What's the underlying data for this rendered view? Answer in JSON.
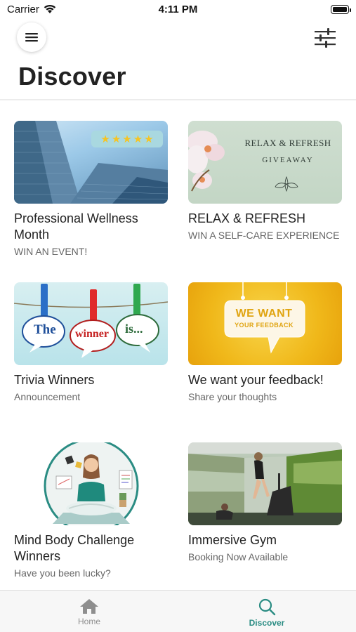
{
  "status_bar": {
    "carrier": "Carrier",
    "time": "4:11 PM"
  },
  "header": {
    "title": "Discover",
    "menu_icon": "hamburger-menu-icon",
    "filter_icon": "sliders-filter-icon"
  },
  "cards": [
    {
      "title": "Professional Wellness Month",
      "subtitle": "WIN AN EVENT!",
      "image": "skyscraper-photo",
      "rating_stars": 5
    },
    {
      "title": "RELAX & REFRESH",
      "subtitle": "WIN A SELF-CARE EXPERIENCE",
      "image": "orchid-giveaway-banner",
      "image_text": {
        "title": "RELAX & REFRESH",
        "sub": "GIVEAWAY"
      }
    },
    {
      "title": "Trivia Winners",
      "subtitle": "Announcement",
      "image": "clothespin-speech-bubbles",
      "image_text": {
        "word1": "The",
        "word2": "winner",
        "word3": "is..."
      }
    },
    {
      "title": "We want your feedback!",
      "subtitle": "Share your thoughts",
      "image": "feedback-sign",
      "image_text": {
        "line1": "WE WANT",
        "line2": "YOUR FEEDBACK"
      }
    },
    {
      "title": "Mind Body Challenge Winners",
      "subtitle": "Have you been lucky?",
      "image": "meditation-illustration"
    },
    {
      "title": "Immersive Gym",
      "subtitle": "Booking Now Available",
      "image": "treadmill-gym-photo"
    }
  ],
  "tab_bar": {
    "home_label": "Home",
    "discover_label": "Discover",
    "home_icon": "house-icon",
    "discover_icon": "search-icon",
    "active_tab": "Discover"
  },
  "colors": {
    "accent": "#2a8c83",
    "inactive": "#8e8e8e",
    "star": "#f6c422"
  }
}
